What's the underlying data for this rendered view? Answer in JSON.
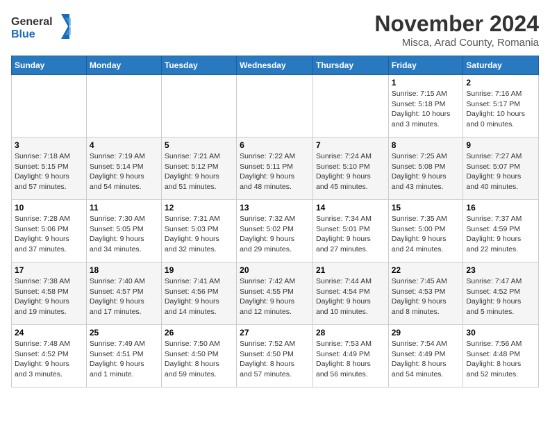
{
  "logo": {
    "line1": "General",
    "line2": "Blue"
  },
  "title": "November 2024",
  "location": "Misca, Arad County, Romania",
  "days_of_week": [
    "Sunday",
    "Monday",
    "Tuesday",
    "Wednesday",
    "Thursday",
    "Friday",
    "Saturday"
  ],
  "weeks": [
    [
      {
        "day": "",
        "info": ""
      },
      {
        "day": "",
        "info": ""
      },
      {
        "day": "",
        "info": ""
      },
      {
        "day": "",
        "info": ""
      },
      {
        "day": "",
        "info": ""
      },
      {
        "day": "1",
        "info": "Sunrise: 7:15 AM\nSunset: 5:18 PM\nDaylight: 10 hours\nand 3 minutes."
      },
      {
        "day": "2",
        "info": "Sunrise: 7:16 AM\nSunset: 5:17 PM\nDaylight: 10 hours\nand 0 minutes."
      }
    ],
    [
      {
        "day": "3",
        "info": "Sunrise: 7:18 AM\nSunset: 5:15 PM\nDaylight: 9 hours\nand 57 minutes."
      },
      {
        "day": "4",
        "info": "Sunrise: 7:19 AM\nSunset: 5:14 PM\nDaylight: 9 hours\nand 54 minutes."
      },
      {
        "day": "5",
        "info": "Sunrise: 7:21 AM\nSunset: 5:12 PM\nDaylight: 9 hours\nand 51 minutes."
      },
      {
        "day": "6",
        "info": "Sunrise: 7:22 AM\nSunset: 5:11 PM\nDaylight: 9 hours\nand 48 minutes."
      },
      {
        "day": "7",
        "info": "Sunrise: 7:24 AM\nSunset: 5:10 PM\nDaylight: 9 hours\nand 45 minutes."
      },
      {
        "day": "8",
        "info": "Sunrise: 7:25 AM\nSunset: 5:08 PM\nDaylight: 9 hours\nand 43 minutes."
      },
      {
        "day": "9",
        "info": "Sunrise: 7:27 AM\nSunset: 5:07 PM\nDaylight: 9 hours\nand 40 minutes."
      }
    ],
    [
      {
        "day": "10",
        "info": "Sunrise: 7:28 AM\nSunset: 5:06 PM\nDaylight: 9 hours\nand 37 minutes."
      },
      {
        "day": "11",
        "info": "Sunrise: 7:30 AM\nSunset: 5:05 PM\nDaylight: 9 hours\nand 34 minutes."
      },
      {
        "day": "12",
        "info": "Sunrise: 7:31 AM\nSunset: 5:03 PM\nDaylight: 9 hours\nand 32 minutes."
      },
      {
        "day": "13",
        "info": "Sunrise: 7:32 AM\nSunset: 5:02 PM\nDaylight: 9 hours\nand 29 minutes."
      },
      {
        "day": "14",
        "info": "Sunrise: 7:34 AM\nSunset: 5:01 PM\nDaylight: 9 hours\nand 27 minutes."
      },
      {
        "day": "15",
        "info": "Sunrise: 7:35 AM\nSunset: 5:00 PM\nDaylight: 9 hours\nand 24 minutes."
      },
      {
        "day": "16",
        "info": "Sunrise: 7:37 AM\nSunset: 4:59 PM\nDaylight: 9 hours\nand 22 minutes."
      }
    ],
    [
      {
        "day": "17",
        "info": "Sunrise: 7:38 AM\nSunset: 4:58 PM\nDaylight: 9 hours\nand 19 minutes."
      },
      {
        "day": "18",
        "info": "Sunrise: 7:40 AM\nSunset: 4:57 PM\nDaylight: 9 hours\nand 17 minutes."
      },
      {
        "day": "19",
        "info": "Sunrise: 7:41 AM\nSunset: 4:56 PM\nDaylight: 9 hours\nand 14 minutes."
      },
      {
        "day": "20",
        "info": "Sunrise: 7:42 AM\nSunset: 4:55 PM\nDaylight: 9 hours\nand 12 minutes."
      },
      {
        "day": "21",
        "info": "Sunrise: 7:44 AM\nSunset: 4:54 PM\nDaylight: 9 hours\nand 10 minutes."
      },
      {
        "day": "22",
        "info": "Sunrise: 7:45 AM\nSunset: 4:53 PM\nDaylight: 9 hours\nand 8 minutes."
      },
      {
        "day": "23",
        "info": "Sunrise: 7:47 AM\nSunset: 4:52 PM\nDaylight: 9 hours\nand 5 minutes."
      }
    ],
    [
      {
        "day": "24",
        "info": "Sunrise: 7:48 AM\nSunset: 4:52 PM\nDaylight: 9 hours\nand 3 minutes."
      },
      {
        "day": "25",
        "info": "Sunrise: 7:49 AM\nSunset: 4:51 PM\nDaylight: 9 hours\nand 1 minute."
      },
      {
        "day": "26",
        "info": "Sunrise: 7:50 AM\nSunset: 4:50 PM\nDaylight: 8 hours\nand 59 minutes."
      },
      {
        "day": "27",
        "info": "Sunrise: 7:52 AM\nSunset: 4:50 PM\nDaylight: 8 hours\nand 57 minutes."
      },
      {
        "day": "28",
        "info": "Sunrise: 7:53 AM\nSunset: 4:49 PM\nDaylight: 8 hours\nand 56 minutes."
      },
      {
        "day": "29",
        "info": "Sunrise: 7:54 AM\nSunset: 4:49 PM\nDaylight: 8 hours\nand 54 minutes."
      },
      {
        "day": "30",
        "info": "Sunrise: 7:56 AM\nSunset: 4:48 PM\nDaylight: 8 hours\nand 52 minutes."
      }
    ]
  ]
}
